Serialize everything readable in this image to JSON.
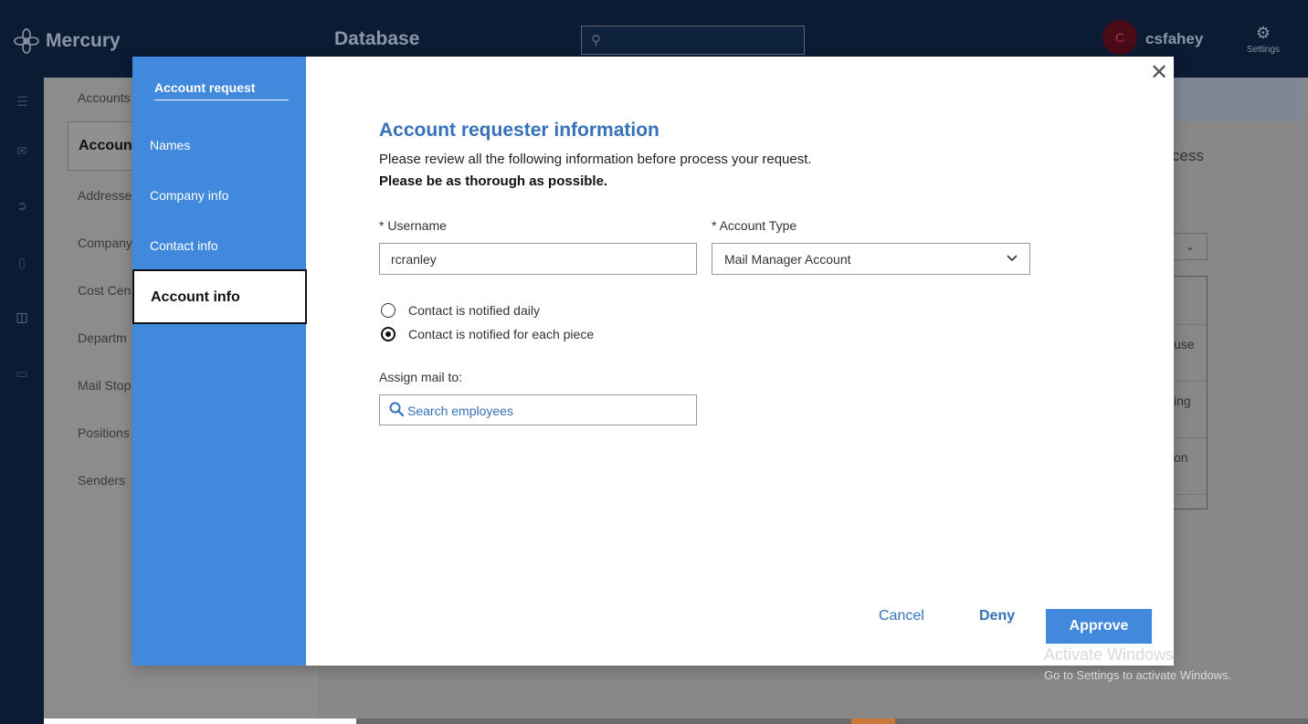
{
  "app": {
    "name": "Mercury",
    "section_title": "Database",
    "user": {
      "initial": "C",
      "name": "csfahey"
    },
    "settings_label": "Settings"
  },
  "rail_icons": [
    "menu-icon",
    "mail-icon",
    "arrow-circle-icon",
    "document-icon",
    "database-icon",
    "monitor-icon"
  ],
  "leftnav": {
    "breadcrumb": "Accounts",
    "active": "Account",
    "items": [
      "Addresses",
      "Company",
      "Cost Cen",
      "Departm",
      "Mail Stop",
      "Positions",
      "Senders"
    ]
  },
  "background_fragments": {
    "process": "cess",
    "row1": "use",
    "row2": "ing",
    "row3": "on",
    "dropdown_chevron": "⌄"
  },
  "modal": {
    "sidebar": {
      "title": "Account request",
      "items": [
        "Names",
        "Company info",
        "Contact info",
        "Account info"
      ],
      "active": "Account info"
    },
    "close_symbol": "✕",
    "heading": "Account requester information",
    "subtitle": "Please review all the following information before process your request.",
    "subtitle_bold": "Please be as thorough as possible.",
    "username": {
      "label": "* Username",
      "value": "rcranley"
    },
    "account_type": {
      "label": "* Account Type",
      "value": "Mail Manager Account"
    },
    "notifications": [
      {
        "label": "Contact is notified daily",
        "selected": false
      },
      {
        "label": "Contact is notified for each piece",
        "selected": true
      }
    ],
    "assign": {
      "label": "Assign mail to:",
      "placeholder": "Search employees"
    },
    "buttons": {
      "cancel": "Cancel",
      "deny": "Deny",
      "approve": "Approve"
    }
  },
  "watermark": {
    "line1": "Activate Windows",
    "line2": "Go to Settings to activate Windows."
  },
  "colors": {
    "accent": "#4189dc",
    "heading": "#3572b9",
    "topbar": "#0b1b33"
  }
}
